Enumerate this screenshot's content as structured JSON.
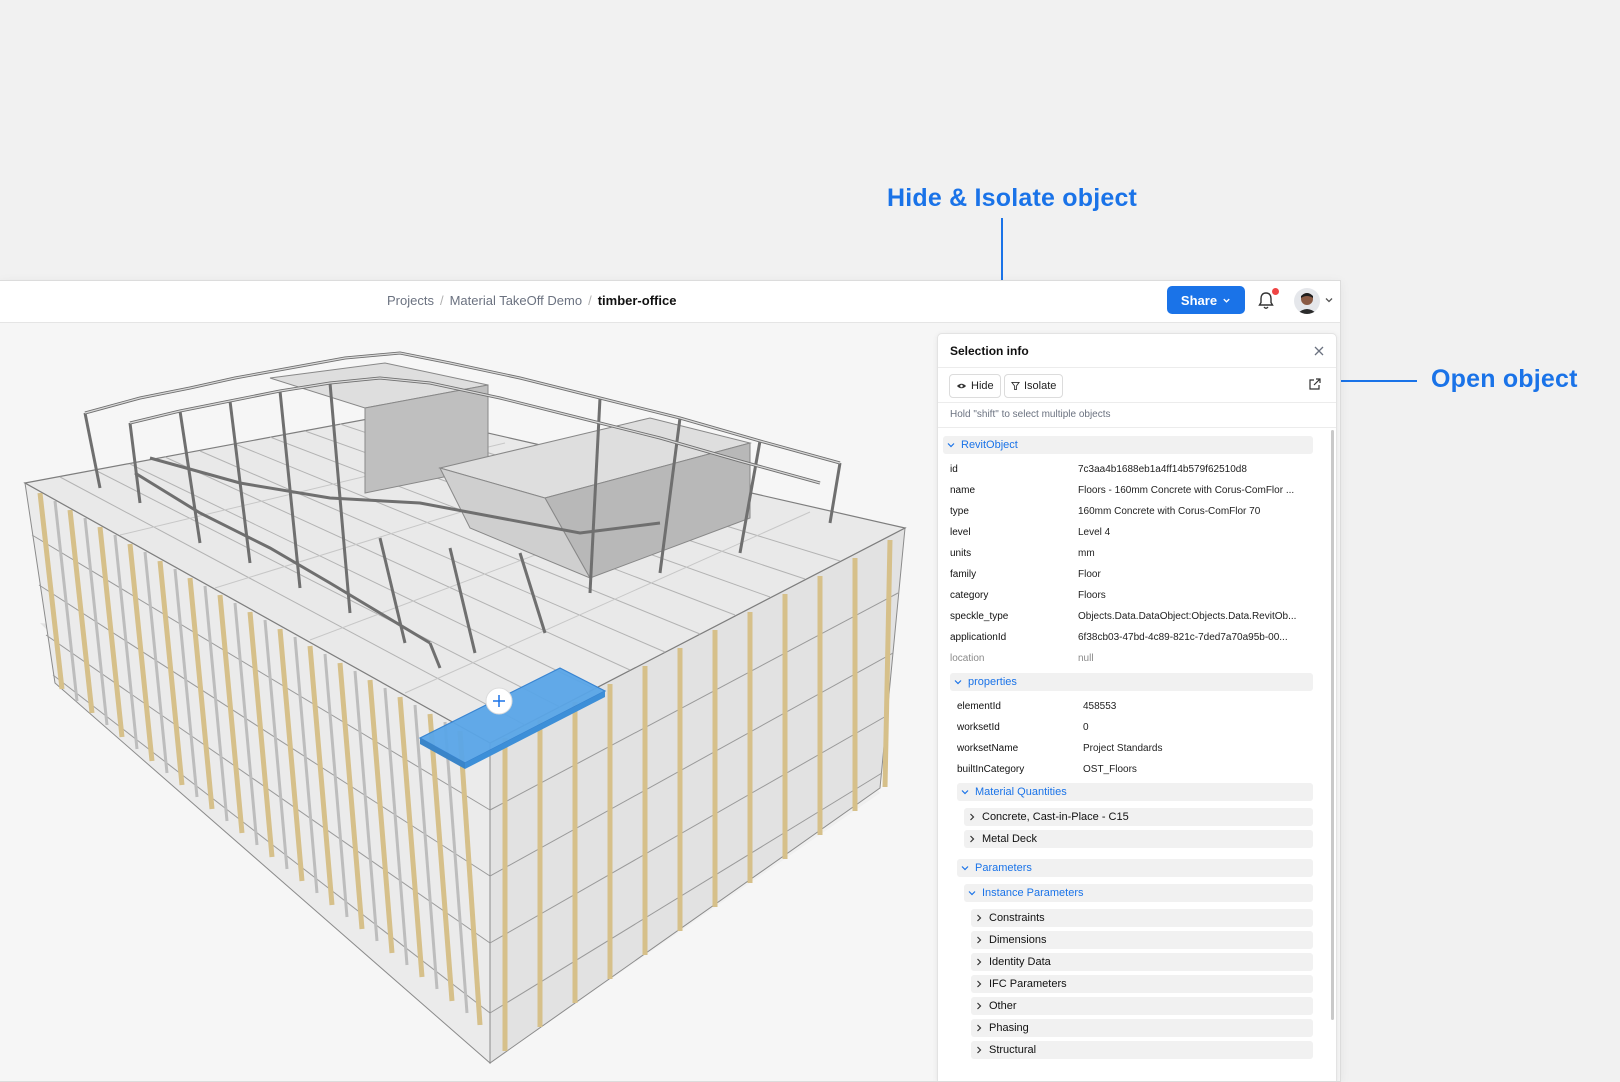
{
  "annotations": {
    "hide_isolate": "Hide & Isolate object",
    "open_object": "Open object"
  },
  "colors": {
    "accent": "#1a73e8",
    "timber": "#e3cf9c",
    "steel": "#9ca3af",
    "selection": "#5aa6e8"
  },
  "breadcrumb": {
    "items": [
      "Projects",
      "Material TakeOff Demo"
    ],
    "separator": "/",
    "current": "timber-office"
  },
  "header": {
    "share_label": "Share"
  },
  "panel": {
    "title": "Selection info",
    "hide_label": "Hide",
    "isolate_label": "Isolate",
    "hint": "Hold \"shift\" to select multiple objects",
    "root_section": "RevitObject",
    "root_rows": [
      {
        "key": "id",
        "value": "7c3aa4b1688eb1a4ff14b579f62510d8"
      },
      {
        "key": "name",
        "value": "Floors - 160mm Concrete with Corus-ComFlor ..."
      },
      {
        "key": "type",
        "value": "160mm Concrete with Corus-ComFlor 70"
      },
      {
        "key": "level",
        "value": "Level 4"
      },
      {
        "key": "units",
        "value": "mm"
      },
      {
        "key": "family",
        "value": "Floor"
      },
      {
        "key": "category",
        "value": "Floors"
      },
      {
        "key": "speckle_type",
        "value": "Objects.Data.DataObject:Objects.Data.RevitOb..."
      },
      {
        "key": "applicationId",
        "value": "6f38cb03-47bd-4c89-821c-7ded7a70a95b-00..."
      },
      {
        "key": "location",
        "value": "null"
      }
    ],
    "properties_section": "properties",
    "properties_rows": [
      {
        "key": "elementId",
        "value": "458553"
      },
      {
        "key": "worksetId",
        "value": "0"
      },
      {
        "key": "worksetName",
        "value": "Project Standards"
      },
      {
        "key": "builtInCategory",
        "value": "OST_Floors"
      }
    ],
    "material_section": "Material Quantities",
    "materials": [
      "Concrete, Cast-in-Place - C15",
      "Metal Deck"
    ],
    "parameters_section": "Parameters",
    "instance_section": "Instance Parameters",
    "instance_groups": [
      "Constraints",
      "Dimensions",
      "Identity Data",
      "IFC Parameters",
      "Other",
      "Phasing",
      "Structural"
    ]
  }
}
